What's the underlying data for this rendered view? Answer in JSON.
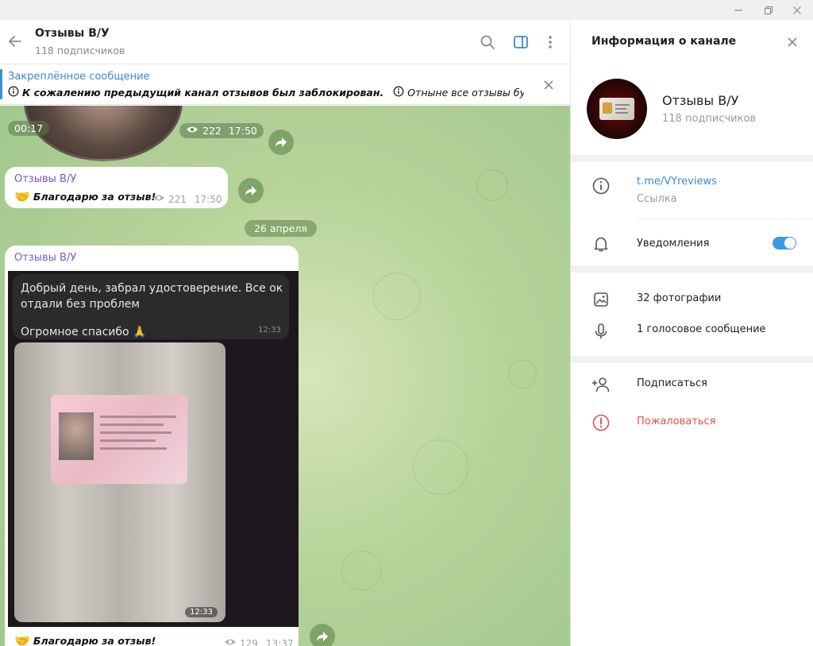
{
  "window": {
    "minimize_icon": "minimize-icon",
    "restore_icon": "restore-icon",
    "close_icon": "close-icon"
  },
  "chat_header": {
    "title": "Отзывы В/У",
    "subtitle": "118 подписчиков"
  },
  "pinned": {
    "label": "Закреплённое сообщение",
    "text_1": "К сожалению предыдущий канал отзывов был заблокирован.",
    "text_2": "Отныне все отзывы будут ..."
  },
  "messages": [
    {
      "type": "video",
      "duration": "00:17",
      "views": "222",
      "time": "17:50"
    },
    {
      "type": "text",
      "sender": "Отзывы В/У",
      "emoji": "🤝",
      "text": "Благодарю за отзыв!",
      "views": "221",
      "time": "17:50"
    },
    {
      "type": "date",
      "text": "26 апреля"
    },
    {
      "type": "forward",
      "sender": "Отзывы В/У",
      "inner_text_line1": "Добрый день, забрал удостоверение. Все ок",
      "inner_text_line2": "отдали без проблем",
      "inner_text_line3": "Огромное спасибо 🙏",
      "inner_time": "12:33",
      "photo_time": "12:33",
      "emoji": "🤝",
      "text": "Благодарю за отзыв!",
      "views": "129",
      "time": "13:37"
    }
  ],
  "info_panel": {
    "title": "Информация о канале",
    "channel_name": "Отзывы В/У",
    "channel_subs": "118 подписчиков",
    "link": "t.me/VYreviews",
    "link_label": "Ссылка",
    "notifications_label": "Уведомления",
    "notifications_on": true,
    "photos": "32 фотографии",
    "voice": "1 голосовое сообщение",
    "subscribe": "Подписаться",
    "report": "Пожаловаться"
  },
  "colors": {
    "accent": "#3a8ccc",
    "sender": "#7b57c9",
    "report": "#e0514f",
    "toggle": "#3d9ae0",
    "chat_bg": "#b7d39a"
  }
}
